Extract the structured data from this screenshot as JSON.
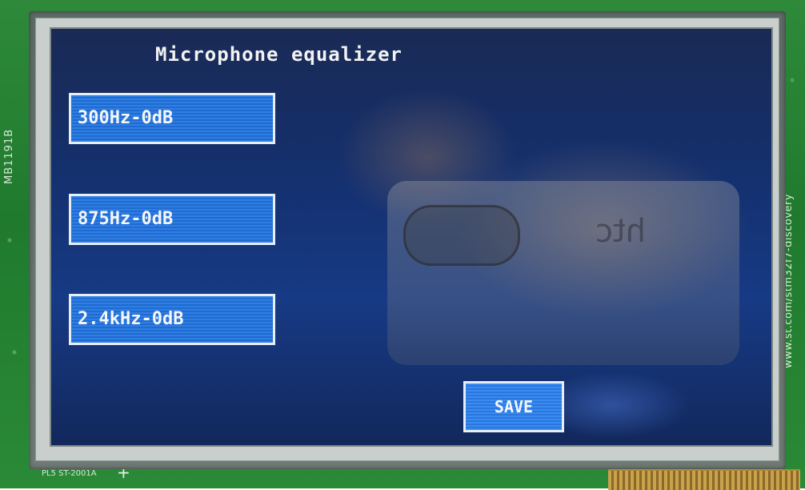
{
  "screen": {
    "title": "Microphone equalizer",
    "bands": [
      {
        "label": "300Hz-0dB"
      },
      {
        "label": "875Hz-0dB"
      },
      {
        "label": "2.4kHz-0dB"
      }
    ],
    "save_label": "SAVE"
  },
  "board": {
    "model_label": "MB1191B",
    "url_label": "www.st.com/stm32f7-discovery",
    "bottom_label": "PL5 ST-2001A",
    "plus_marker": "+"
  },
  "reflection": {
    "brand": "htc"
  },
  "colors": {
    "button_fill": "#2a76e0",
    "button_border": "#e6eef8",
    "screen_bg": "#163476",
    "pcb_green": "#2a8a36",
    "text": "#f2f2f2"
  }
}
